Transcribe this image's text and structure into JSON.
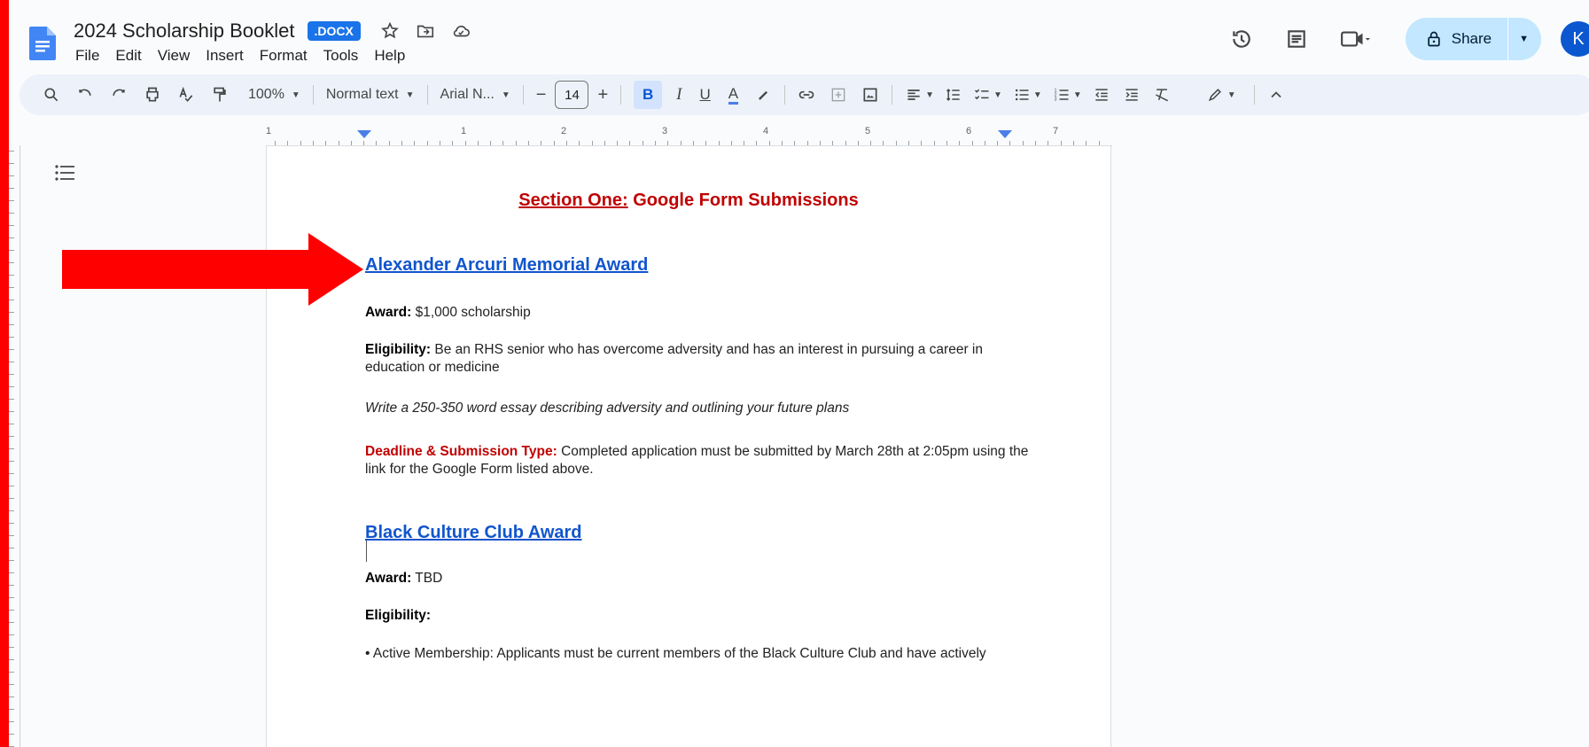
{
  "doc": {
    "title": "2024 Scholarship Booklet",
    "badge": ".DOCX",
    "menu": [
      "File",
      "Edit",
      "View",
      "Insert",
      "Format",
      "Tools",
      "Help"
    ],
    "share_label": "Share",
    "avatar_initial": "K"
  },
  "toolbar": {
    "zoom": "100%",
    "style": "Normal text",
    "font": "Arial N...",
    "font_size": "14",
    "bold": "B",
    "italic": "I",
    "underline": "U",
    "text_color": "A"
  },
  "ruler": {
    "numbers": [
      "1",
      "1",
      "2",
      "3",
      "4",
      "5",
      "6",
      "7"
    ]
  },
  "content": {
    "section_title_prefix": "Section One:",
    "section_title_rest": " Google Form Submissions",
    "award1": {
      "title": "Alexander Arcuri Memorial Award",
      "award_label": "Award:",
      "award_value": " $1,000 scholarship",
      "elig_label": "Eligibility:",
      "elig_value": " Be an RHS senior who has overcome adversity and has an interest in pursuing a career in education or medicine",
      "essay": "Write a 250-350 word essay describing adversity and outlining your future plans",
      "deadline_label": "Deadline & Submission Type:",
      "deadline_value": " Completed application must be submitted by March 28th at 2:05pm using the link for the Google Form listed above."
    },
    "award2": {
      "title": "Black Culture Club Award",
      "award_label": "Award:",
      "award_value": " TBD",
      "elig_label": "Eligibility:",
      "bullet": "• Active Membership: Applicants must be current members of the Black Culture Club and have actively"
    }
  },
  "colors": {
    "frame": "#ff0000",
    "accent": "#1a73e8",
    "link": "#1155cc",
    "heading_red": "#c00000"
  }
}
